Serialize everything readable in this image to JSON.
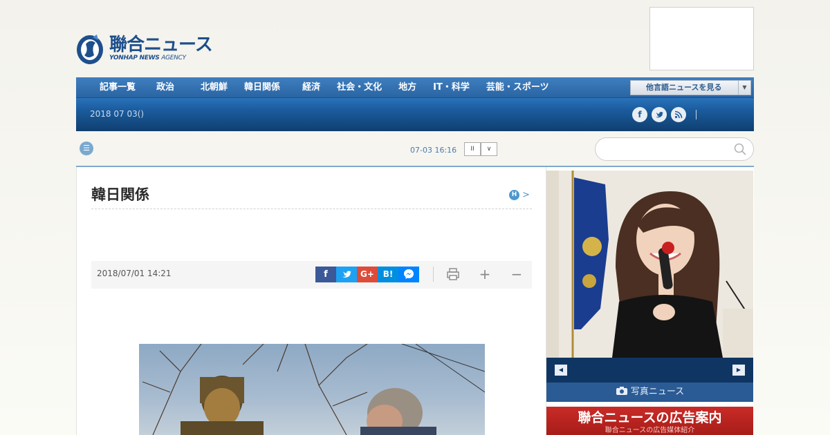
{
  "header": {
    "logo_jp": "聯合ニュース",
    "logo_en_bold": "YONHAP NEWS",
    "logo_en_italic": "AGENCY"
  },
  "nav": {
    "items": [
      "記事一覧",
      "政治",
      "北朝鮮",
      "韓日関係",
      "経済",
      "社会・文化",
      "地方",
      "IT・科学",
      "芸能・スポーツ"
    ],
    "lang_button": "他言語ニュースを見る",
    "date": "2018 07 03()"
  },
  "social_icons": [
    "facebook-icon",
    "twitter-icon",
    "rss-icon"
  ],
  "ticker": {
    "time": "07-03 16:16",
    "pause_label": "II",
    "next_label": "∨"
  },
  "search": {
    "placeholder": ""
  },
  "article": {
    "section_title": "韓日関係",
    "h_badge": "H",
    "h_arrow": ">",
    "date": "2018/07/01 14:21",
    "share_buttons": [
      "f",
      "t",
      "G+",
      "B!",
      "m"
    ]
  },
  "sidebar": {
    "photo_news_label": "写真ニュース",
    "ad_title": "聯合ニュースの広告案内",
    "ad_sub": "聯合ニュースの広告媒体紹介"
  },
  "colors": {
    "nav_blue": "#2a6fb4",
    "accent_red": "#c92b27",
    "facebook": "#3b5998",
    "twitter": "#1da1f2",
    "googleplus": "#dd4b39",
    "hatena": "#008fde",
    "messenger": "#0084ff"
  }
}
